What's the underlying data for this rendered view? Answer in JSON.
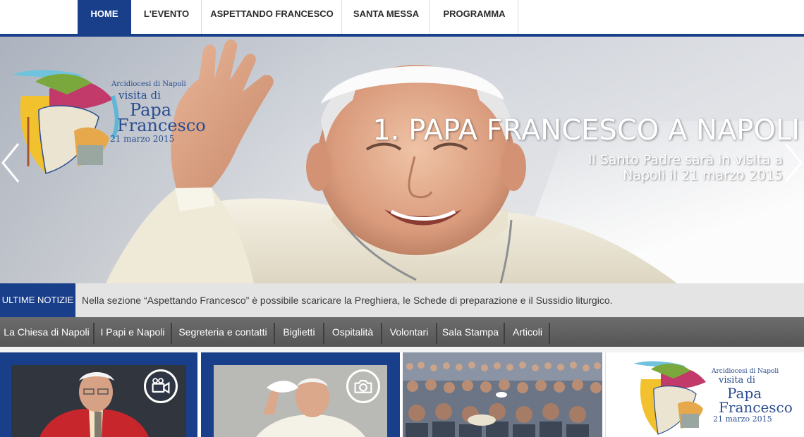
{
  "nav": {
    "items": [
      {
        "label": "HOME",
        "active": true
      },
      {
        "label": "L'EVENTO",
        "active": false
      },
      {
        "label": "ASPETTANDO FRANCESCO",
        "active": false
      },
      {
        "label": "SANTA MESSA",
        "active": false
      },
      {
        "label": "PROGRAMMA",
        "active": false
      }
    ]
  },
  "logo": {
    "line1": "Arcidiocesi di Napoli",
    "line2": "visita di",
    "line3": "Papa",
    "line4": "Francesco",
    "line5": "21 marzo 2015"
  },
  "hero": {
    "title": "1. PAPA FRANCESCO A NAPOLI",
    "subtitle": "Il Santo Padre sarà in visita a Napoli il 21 marzo 2015",
    "prev_icon": "chevron-left-icon",
    "next_icon": "chevron-right-icon"
  },
  "ticker": {
    "label": "ULTIME NOTIZIE",
    "text": "Nella sezione “Aspettando Francesco” è possibile scaricare la Preghiera, le Schede di preparazione e il Sussidio liturgico."
  },
  "subnav": {
    "items": [
      {
        "label": "La Chiesa di Napoli"
      },
      {
        "label": "I Papi e Napoli"
      },
      {
        "label": "Segreteria e contatti"
      },
      {
        "label": "Biglietti"
      },
      {
        "label": "Ospitalità"
      },
      {
        "label": "Volontari"
      },
      {
        "label": "Sala Stampa"
      },
      {
        "label": "Articoli"
      }
    ]
  },
  "tiles": [
    {
      "type": "video",
      "icon": "video-camera-icon"
    },
    {
      "type": "photo",
      "icon": "camera-icon"
    },
    {
      "type": "crowd-photo"
    },
    {
      "type": "logo"
    }
  ],
  "colors": {
    "primary_blue": "#1a3f8a",
    "ticker_bg": "#e4e4e4",
    "subnav_bg": "#5f5f5f",
    "logo_text": "#2b4d8f"
  }
}
